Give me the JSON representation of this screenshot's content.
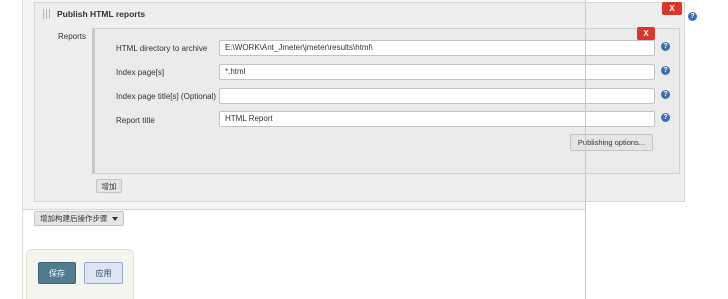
{
  "section": {
    "title": "Publish HTML reports",
    "delete_label": "X"
  },
  "reports": {
    "label": "Reports",
    "delete_label": "X",
    "fields": [
      {
        "label": "HTML directory to archive",
        "value": "E:\\WORK\\Ant_Jmeter\\jmeter\\results\\html\\",
        "help": "?"
      },
      {
        "label": "Index page[s]",
        "value": "*.html",
        "help": "?"
      },
      {
        "label": "Index page title[s] (Optional)",
        "value": "",
        "help": "?"
      },
      {
        "label": "Report title",
        "value": "HTML Report",
        "help": "?"
      }
    ],
    "publishing_options_label": "Publishing options...",
    "add_label": "增加"
  },
  "outer_help": "?",
  "add_post_build_label": "增加构建后操作步骤",
  "footer": {
    "save_label": "保存",
    "apply_label": "应用"
  },
  "colors": {
    "delete_red": "#d8382c",
    "help_blue": "#3d6db3",
    "save_teal": "#4f7c8e"
  }
}
